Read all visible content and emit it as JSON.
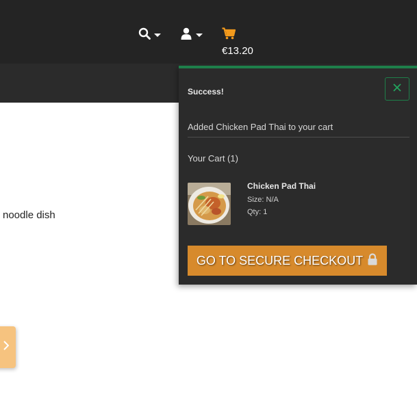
{
  "header": {
    "search_icon": "search-icon",
    "account_icon": "user-icon",
    "cart_icon": "cart-icon",
    "cart_total": "€13.20",
    "accent_color": "#f39a1c"
  },
  "content": {
    "description_fragment": "noodle dish"
  },
  "cart_popup": {
    "success_title": "Success!",
    "close_label": "×",
    "added_message": "Added Chicken Pad Thai to your cart",
    "cart_heading": "Your Cart (1)",
    "item": {
      "name": "Chicken Pad Thai",
      "size": "Size: N/A",
      "qty": "Qty: 1",
      "thumbnail": "pad-thai-photo"
    },
    "checkout_label": "GO TO SECURE CHECKOUT",
    "checkout_icon": "lock-icon",
    "border_color": "#1e7f4a",
    "button_color": "#d78a2c"
  }
}
